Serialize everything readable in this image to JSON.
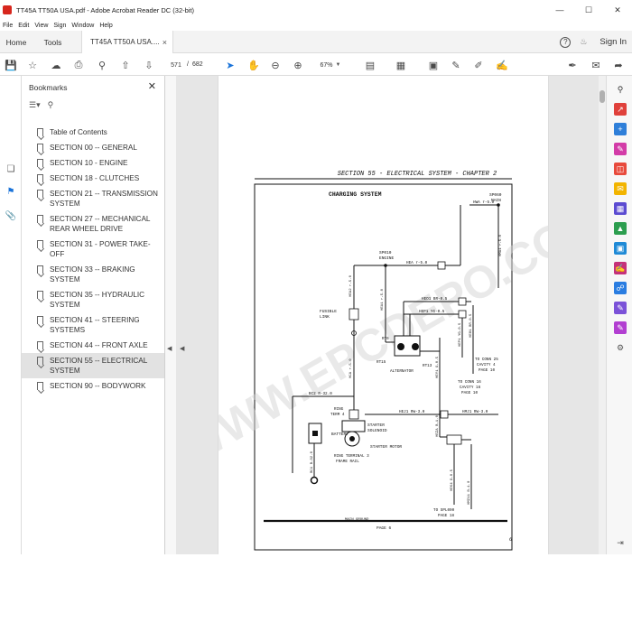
{
  "window": {
    "title": "TT45A TT50A USA.pdf - Adobe Acrobat Reader DC (32-bit)",
    "controls": [
      "—",
      "☐",
      "✕"
    ]
  },
  "menu": [
    "File",
    "Edit",
    "View",
    "Sign",
    "Window",
    "Help"
  ],
  "tabs": {
    "home": "Home",
    "tools": "Tools",
    "document": "TT45A TT50A USA....",
    "close": "×",
    "help": "?",
    "bell": "🔔",
    "sign_in": "Sign In"
  },
  "toolbar": {
    "page_current": "571",
    "page_separator": "/",
    "page_total": "682",
    "zoom": "67%"
  },
  "bookmarks": {
    "header": "Bookmarks",
    "close": "✕",
    "items": [
      {
        "label": "Table of Contents"
      },
      {
        "label": "SECTION 00 -- GENERAL"
      },
      {
        "label": "SECTION 10 - ENGINE"
      },
      {
        "label": "SECTION 18 - CLUTCHES"
      },
      {
        "label": "SECTION 21 -- TRANSMISSION SYSTEM"
      },
      {
        "label": "SECTION 27 -- MECHANICAL REAR WHEEL DRIVE"
      },
      {
        "label": "SECTION 31 - POWER TAKE-OFF"
      },
      {
        "label": "SECTION 33 -- BRAKING SYSTEM"
      },
      {
        "label": "SECTION 35 -- HYDRAULIC SYSTEM"
      },
      {
        "label": "SECTION 41 -- STEERING SYSTEMS"
      },
      {
        "label": "SECTION 44 -- FRONT AXLE"
      },
      {
        "label": "SECTION 55 -- ELECTRICAL SYSTEM",
        "selected": true
      },
      {
        "label": "SECTION 90 -- BODYWORK"
      }
    ]
  },
  "document_page": {
    "header": "SECTION 55 - ELECTRICAL SYSTEM - CHAPTER 2",
    "diagram_title": "CHARGING SYSTEM",
    "page_label": "PAGE 6",
    "page_number": "6",
    "watermark": "WWW.EPCDEPO.COM",
    "labels": {
      "sp060": "SP060",
      "main1": "MAIN",
      "hwa": "HWA r-5.0",
      "sp010": "SP010",
      "engine": "ENGINE",
      "hea": "HEA r-5.0",
      "fusible1": "FUSIBLE",
      "fusible2": "LINK",
      "heo1": "HEO1 BR-0.5",
      "hep1": "HEP1 YG-0.5",
      "rt6": "RT6",
      "rt15": "RT15",
      "rt13": "RT13",
      "alternator": "ALTERNATOR",
      "conn25a": "TO CONN 25",
      "conn25b": "CAVITY 4",
      "conn25c": "PAGE 10",
      "conn16a": "TO CONN 16",
      "conn16b": "CAVITY 16",
      "conn16c": "PAGE 10",
      "bc2": "BC2 R-32.0",
      "ring1": "RING",
      "ring2": "TERM 4",
      "battery": "BATTERY",
      "solenoid1": "STARTER",
      "solenoid2": "SOLENOID",
      "motor": "STARTER MOTOR",
      "hej1": "HEJ1 RW-3.0",
      "hmj1": "HMJ1 RW-3.0",
      "ringterm1": "RING TERMINAL 3",
      "ringterm2": "FRAME RAIL",
      "spl1": "TO SPL090",
      "spl2": "PAGE 18",
      "mainground": "MAIN GROUND",
      "hea2": "HEA2 r-5.0",
      "hea1": "HEA1 r-5.0",
      "hmae": "HMA1 r-5.0",
      "bc1": "BC1 B-32.0",
      "hca": "HCA r-5.0",
      "heo1v": "HEO1 BR-0.5",
      "hep1v": "HEP1 YG-0.5",
      "hey1": "HEY1 G-0.5",
      "hez": "HEZA B-1.0",
      "hek": "HEK4 G-0.5",
      "hmz": "HMZ11 B-1.0"
    }
  },
  "icons": {
    "left_rail": [
      "page-thumbnails-icon",
      "bookmark-icon",
      "attachment-icon"
    ],
    "right_panel_colors": [
      "#e0413b",
      "#2f7fd9",
      "#d33ca8",
      "#e84a3c",
      "#f2b400",
      "#5b4bd1",
      "#2c9e4f",
      "#1f8ad6",
      "#c5317a",
      "#7b52d8",
      "#2a7de1",
      "#b23fd1",
      "#555555"
    ]
  }
}
